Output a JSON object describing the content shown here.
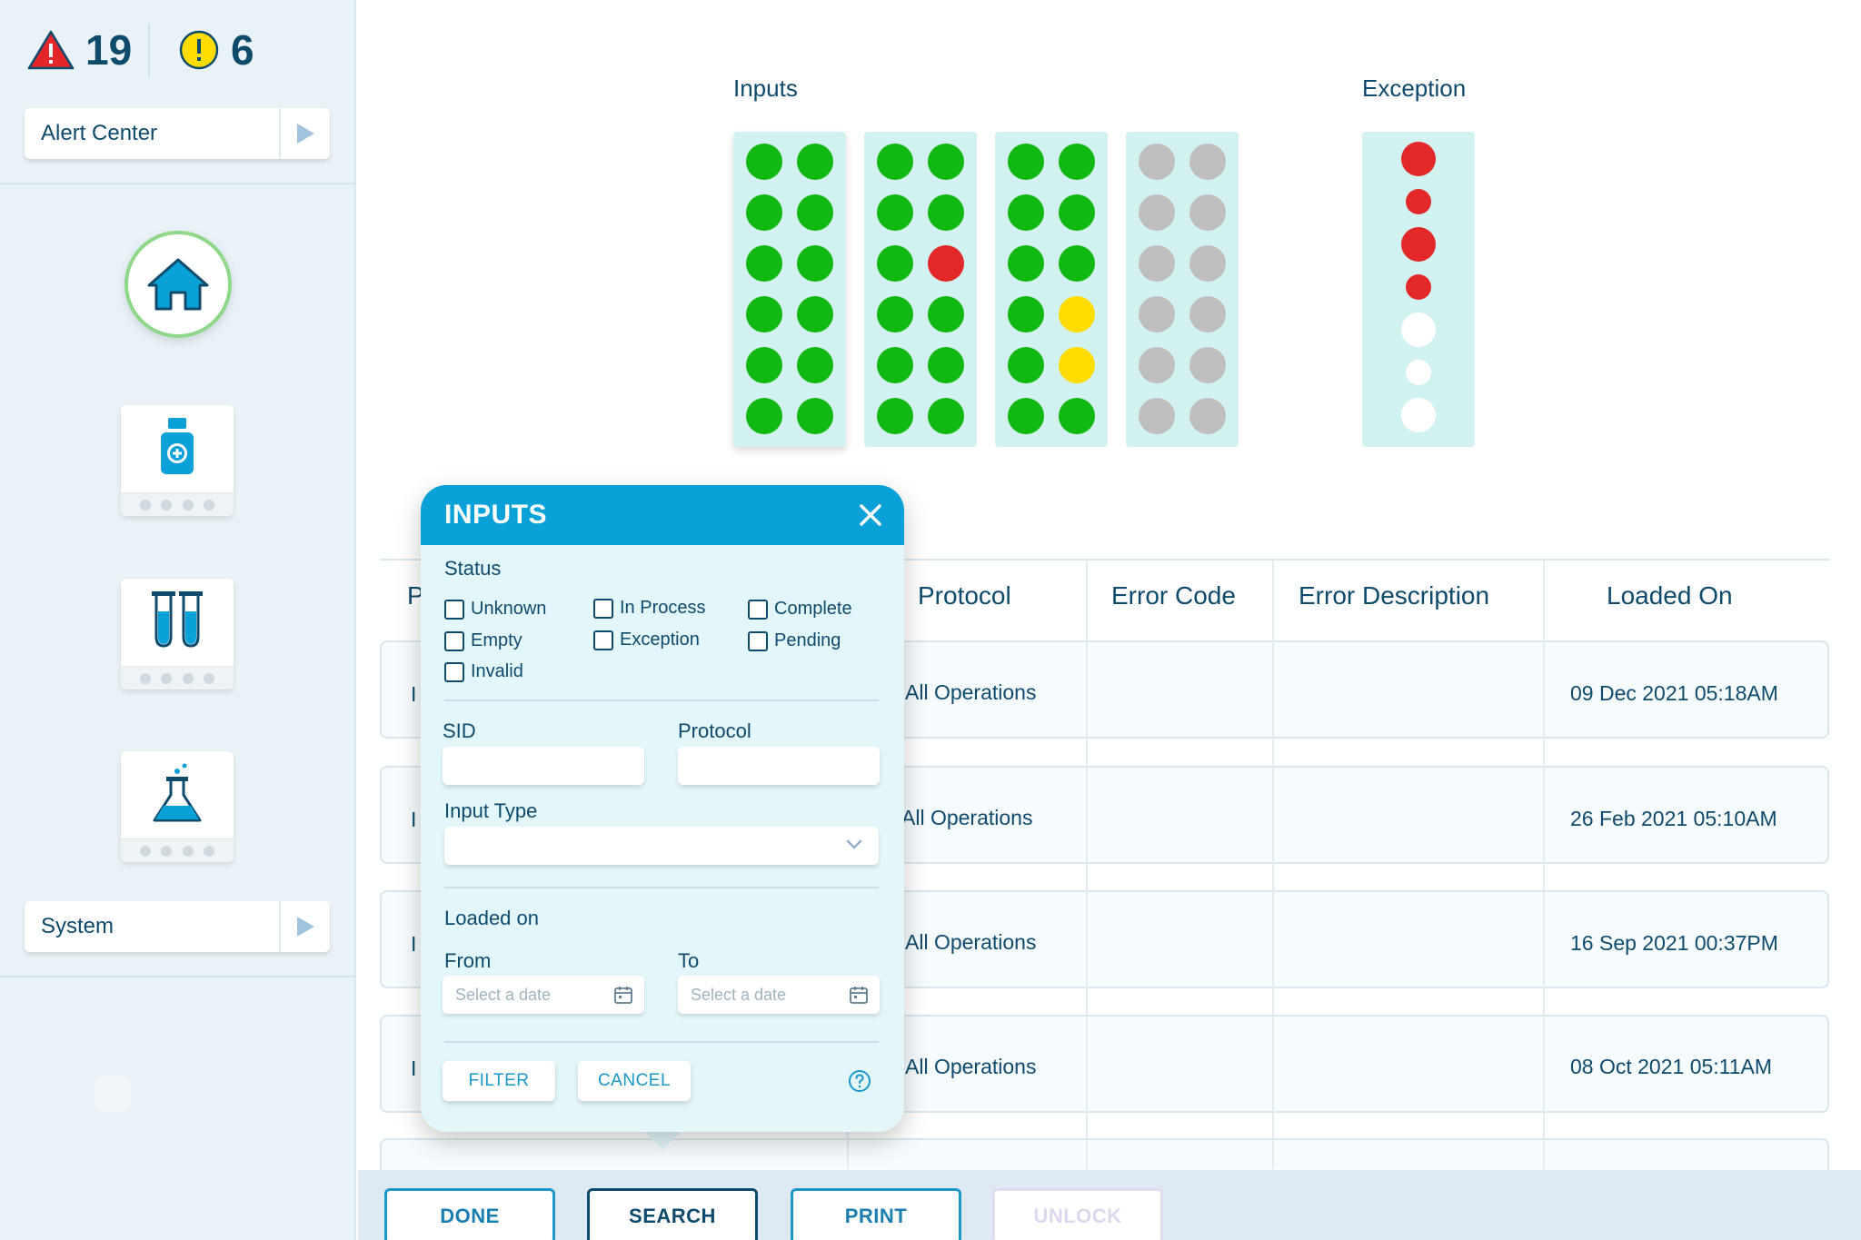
{
  "sidebar": {
    "error_count": "19",
    "warning_count": "6",
    "alert_center_label": "Alert Center",
    "system_label": "System"
  },
  "racks": {
    "inputs_title": "Inputs",
    "exception_title": "Exception",
    "input_racks": [
      [
        "green",
        "green",
        "green",
        "green",
        "green",
        "green",
        "green",
        "green",
        "green",
        "green",
        "green",
        "green"
      ],
      [
        "green",
        "green",
        "green",
        "green",
        "green",
        "red",
        "green",
        "green",
        "green",
        "green",
        "green",
        "green"
      ],
      [
        "green",
        "green",
        "green",
        "green",
        "green",
        "green",
        "green",
        "yellow",
        "green",
        "yellow",
        "green",
        "green"
      ],
      [
        "gray",
        "gray",
        "gray",
        "gray",
        "gray",
        "gray",
        "gray",
        "gray",
        "gray",
        "gray",
        "gray",
        "gray"
      ]
    ],
    "exception_wells": [
      "red",
      "red",
      "red",
      "red",
      "white",
      "white",
      "white"
    ]
  },
  "table": {
    "headers": {
      "protocol": "Protocol",
      "error_code": "Error Code",
      "error_description": "Error Description",
      "loaded_on": "Loaded On"
    },
    "partial_header": "P",
    "rows": [
      {
        "frag": "I",
        "protocol": "All Operations",
        "loaded_on": "09 Dec 2021   05:18AM"
      },
      {
        "frag": "I",
        "protocol": "All Operations",
        "loaded_on": "26 Feb 2021   05:10AM"
      },
      {
        "frag": "I",
        "protocol": "All Operations",
        "loaded_on": "16 Sep 2021   00:37PM"
      },
      {
        "frag": "I",
        "protocol": "All Operations",
        "loaded_on": "08 Oct 2021   05:11AM"
      }
    ]
  },
  "modal": {
    "title": "INPUTS",
    "status_label": "Status",
    "statuses": [
      "Unknown",
      "In Process",
      "Complete",
      "Empty",
      "Exception",
      "Pending",
      "Invalid"
    ],
    "sid_label": "SID",
    "protocol_label": "Protocol",
    "input_type_label": "Input Type",
    "loaded_on_label": "Loaded on",
    "from_label": "From",
    "to_label": "To",
    "from_placeholder": "Select a date",
    "to_placeholder": "Select a date",
    "filter_label": "FILTER",
    "cancel_label": "CANCEL"
  },
  "bottom_bar": {
    "done": "DONE",
    "search": "SEARCH",
    "print": "PRINT",
    "unlock": "UNLOCK"
  },
  "colors": {
    "primary_blue": "#0aa0d8",
    "navy_text": "#0d4a6b",
    "well_green": "#12b812",
    "well_red": "#e22828",
    "well_yellow": "#ffdd00",
    "well_gray": "#bfbfbf",
    "rack_bg": "#d2f1f1"
  }
}
